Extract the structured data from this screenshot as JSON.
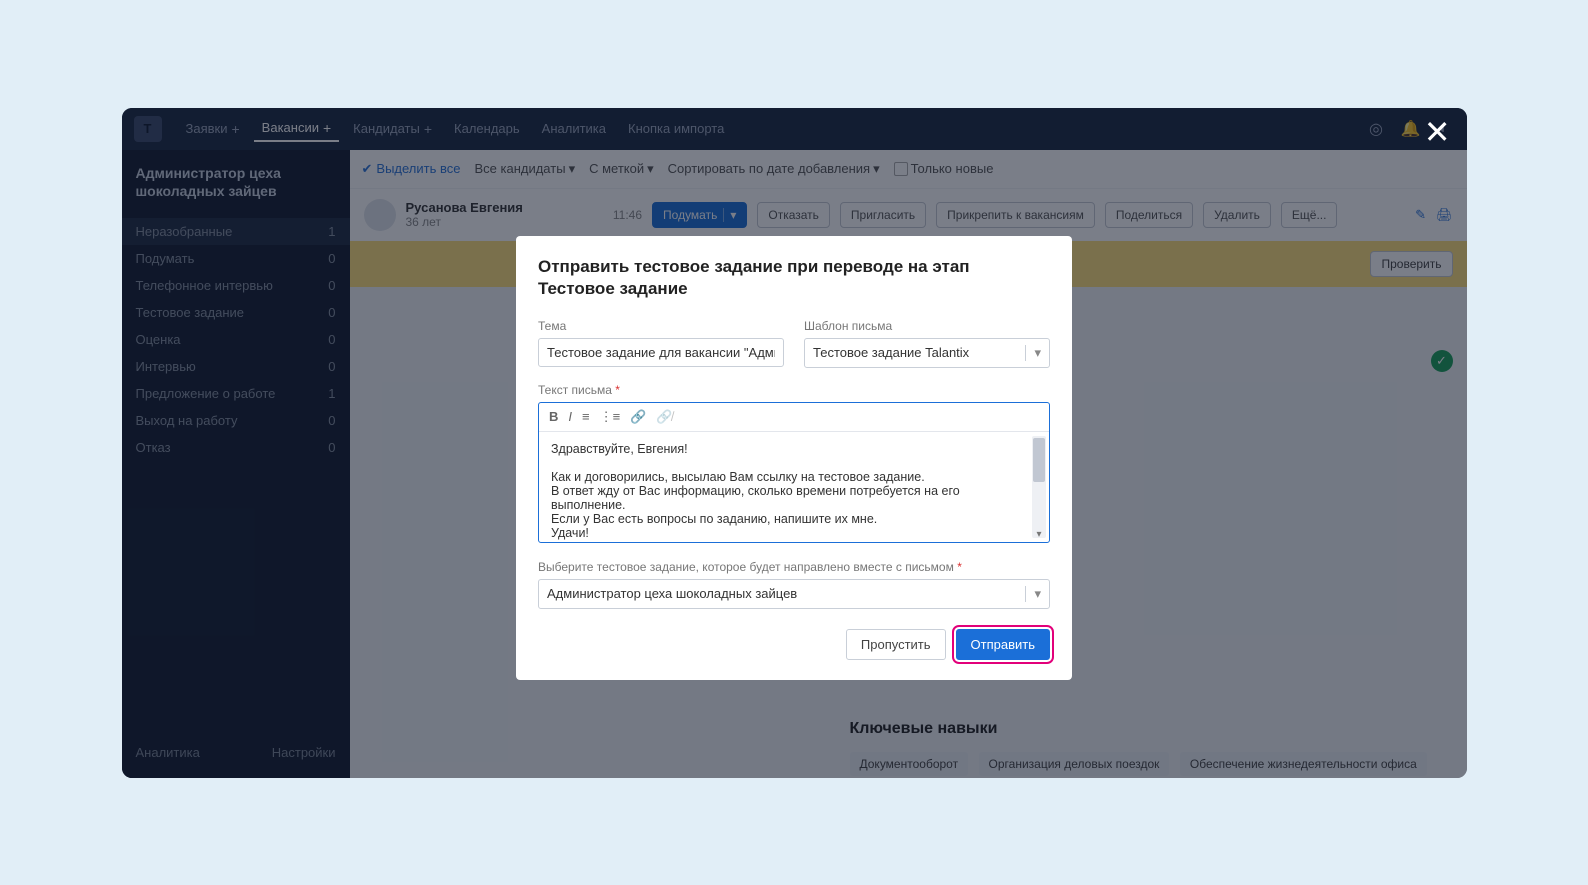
{
  "nav": {
    "items": [
      {
        "label": "Заявки",
        "plus": true
      },
      {
        "label": "Вакансии",
        "plus": true,
        "active": true
      },
      {
        "label": "Кандидаты",
        "plus": true
      },
      {
        "label": "Календарь"
      },
      {
        "label": "Аналитика"
      },
      {
        "label": "Кнопка импорта"
      }
    ]
  },
  "sidebar": {
    "title": "Администратор цеха шоколадных зайцев",
    "stages": [
      {
        "label": "Неразобранные",
        "count": "1",
        "active": true
      },
      {
        "label": "Подумать",
        "count": "0"
      },
      {
        "label": "Телефонное интервью",
        "count": "0"
      },
      {
        "label": "Тестовое задание",
        "count": "0"
      },
      {
        "label": "Оценка",
        "count": "0"
      },
      {
        "label": "Интервью",
        "count": "0"
      },
      {
        "label": "Предложение о работе",
        "count": "1"
      },
      {
        "label": "Выход на работу",
        "count": "0"
      },
      {
        "label": "Отказ",
        "count": "0"
      }
    ],
    "footer": {
      "a": "Аналитика",
      "b": "Настройки"
    }
  },
  "toolbar": {
    "selectAll": "Выделить все",
    "allCand": "Все кандидаты",
    "withLabel": "С меткой",
    "sort": "Сортировать по дате добавления",
    "onlyNew": "Только новые"
  },
  "candidate": {
    "name": "Русанова Евгения",
    "age": "36 лет",
    "time": "11:46",
    "think": "Подумать",
    "reject": "Отказать",
    "invite": "Пригласить",
    "attach": "Прикрепить к вакансиям",
    "share": "Поделиться",
    "delete": "Удалить",
    "more": "Ещё..."
  },
  "yellow": {
    "check": "Проверить"
  },
  "skills": {
    "title": "Ключевые навыки",
    "tags": [
      "Документооборот",
      "Организация деловых поездок",
      "Обеспечение жизнедеятельности офиса"
    ]
  },
  "modal": {
    "title": "Отправить тестовое задание при переводе на этап Тестовое задание",
    "subjectLabel": "Тема",
    "subjectValue": "Тестовое задание для вакансии \"Администра",
    "templateLabel": "Шаблон письма",
    "templateValue": "Тестовое задание Talantix",
    "bodyLabel": "Текст письма",
    "bodyLines": [
      "Здравствуйте, Евгения!",
      "",
      "Как и договорились, высылаю Вам ссылку на тестовое задание.",
      "В ответ жду от Вас информацию, сколько времени потребуется на его выполнение.",
      "Если у Вас есть вопросы по заданию, напишите их мне.",
      "Удачи!"
    ],
    "testSelectLabel": "Выберите тестовое задание, которое будет направлено вместе с письмом",
    "testSelectValue": "Администратор цеха шоколадных зайцев",
    "skip": "Пропустить",
    "send": "Отправить"
  }
}
